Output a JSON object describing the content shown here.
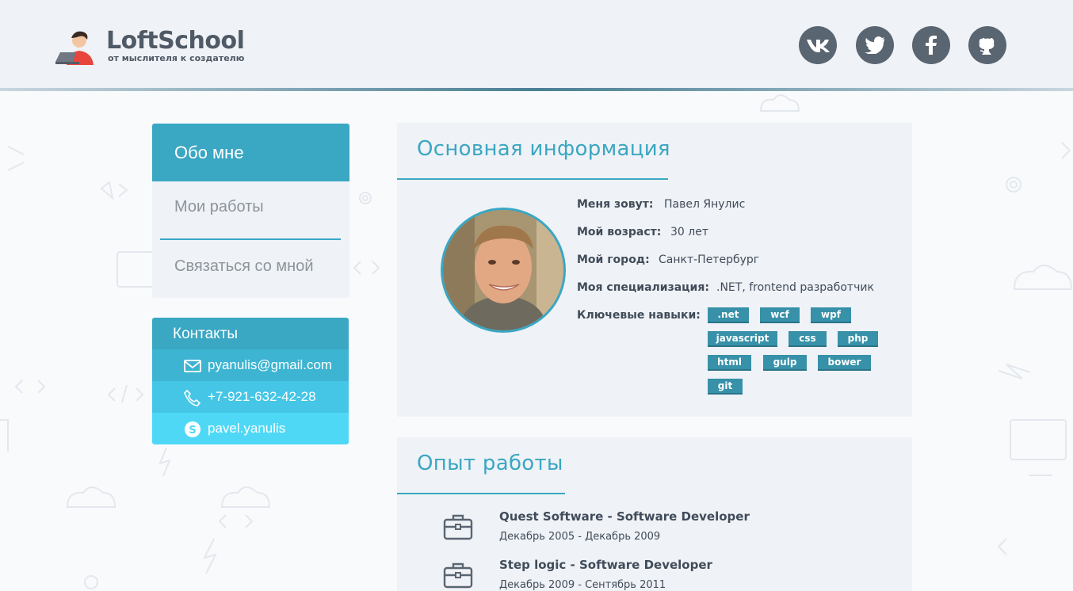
{
  "header": {
    "logo_title": "LoftSchool",
    "logo_subtitle": "от мыслителя к создателю",
    "social": [
      {
        "name": "vk-icon"
      },
      {
        "name": "twitter-icon"
      },
      {
        "name": "facebook-icon"
      },
      {
        "name": "github-icon"
      }
    ]
  },
  "nav": {
    "items": [
      {
        "label": "Обо мне",
        "active": true
      },
      {
        "label": "Мои работы",
        "active": false
      },
      {
        "label": "Связаться со мной",
        "active": false
      }
    ]
  },
  "contacts": {
    "title": "Контакты",
    "email": "pyanulis@gmail.com",
    "phone": "+7-921-632-42-28",
    "skype": "pavel.yanulis"
  },
  "basic_info": {
    "title": "Основная информация",
    "name_label": "Меня зовут:",
    "name_value": "Павел Янулис",
    "age_label": "Мой возраст:",
    "age_value": "30 лет",
    "city_label": "Мой город:",
    "city_value": "Санкт-Петербург",
    "spec_label": "Моя специализация:",
    "spec_value": ".NET, frontend разработчик",
    "skills_label": "Ключевые навыки:",
    "skills": [
      ".net",
      "wcf",
      "wpf",
      "javascript",
      "css",
      "php",
      "html",
      "gulp",
      "bower",
      "git"
    ]
  },
  "experience": {
    "title": "Опыт работы",
    "jobs": [
      {
        "title": "Quest Software - Software Developer",
        "dates": "Декабрь 2005 - Декабрь 2009"
      },
      {
        "title": "Step logic - Software Developer",
        "dates": "Декабрь 2009 - Сентябрь 2011"
      }
    ]
  },
  "colors": {
    "accent": "#3aa7c3",
    "contact_row_1": "#3db4d2",
    "contact_row_2": "#46c6e6",
    "contact_row_3": "#4fd8f6",
    "skill_bg": "#3791a8",
    "text": "#414c5a",
    "social_bg": "#5a6572"
  }
}
